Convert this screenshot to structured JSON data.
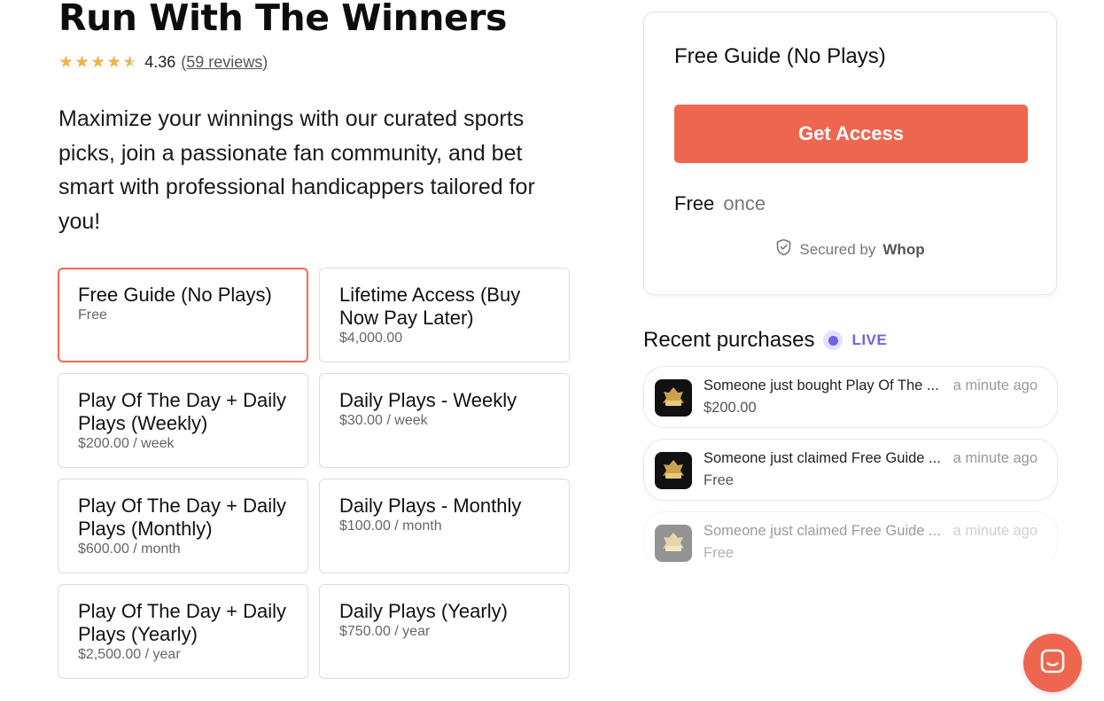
{
  "product": {
    "title": "Run With The Winners",
    "rating_value": "4.36",
    "reviews_label": "(59 reviews)",
    "rating_stars": 4.36,
    "description": "Maximize your winnings with our curated sports picks, join a passionate fan community, and bet smart with professional handicappers tailored for you!"
  },
  "plans": [
    {
      "name": "Free Guide (No Plays)",
      "price": "Free",
      "selected": true
    },
    {
      "name": "Lifetime Access (Buy Now Pay Later)",
      "price": "$4,000.00",
      "selected": false
    },
    {
      "name": "Play Of The Day + Daily Plays (Weekly)",
      "price": "$200.00 / week",
      "selected": false
    },
    {
      "name": "Daily Plays - Weekly",
      "price": "$30.00 / week",
      "selected": false
    },
    {
      "name": "Play Of The Day + Daily Plays (Monthly)",
      "price": "$600.00 / month",
      "selected": false
    },
    {
      "name": "Daily Plays - Monthly",
      "price": "$100.00 / month",
      "selected": false
    },
    {
      "name": "Play Of The Day + Daily Plays (Yearly)",
      "price": "$2,500.00 / year",
      "selected": false
    },
    {
      "name": "Daily Plays (Yearly)",
      "price": "$750.00 / year",
      "selected": false
    }
  ],
  "checkout": {
    "plan_title": "Free Guide (No Plays)",
    "button_label": "Get Access",
    "price": "Free",
    "frequency": "once",
    "secured_prefix": "Secured by",
    "secured_brand": "Whop"
  },
  "recent": {
    "title": "Recent purchases",
    "live_label": "LIVE",
    "items": [
      {
        "text": "Someone just bought Play Of The ...",
        "sub": "$200.00",
        "time": "a minute ago"
      },
      {
        "text": "Someone just claimed Free Guide ...",
        "sub": "Free",
        "time": "a minute ago"
      },
      {
        "text": "Someone just claimed Free Guide ...",
        "sub": "Free",
        "time": "a minute ago"
      }
    ]
  },
  "colors": {
    "accent": "#ee6650",
    "star": "#ebb54a",
    "live": "#6c63e6"
  },
  "icons": [
    "star-icon",
    "shield-check-icon",
    "chat-icon",
    "product-logo-icon"
  ]
}
